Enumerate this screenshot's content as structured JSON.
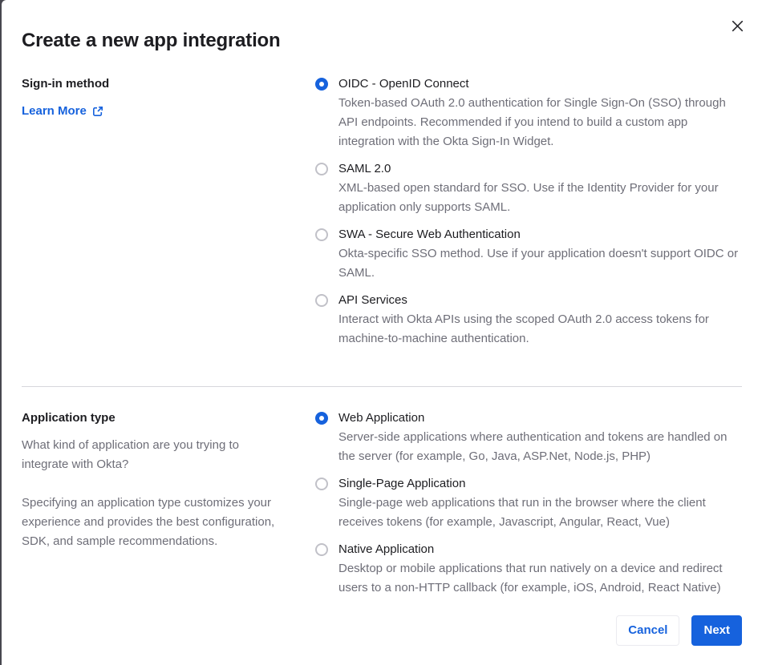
{
  "modal": {
    "title": "Create a new app integration"
  },
  "colors": {
    "accent": "#1662dd",
    "text": "#1d1d21",
    "muted_text": "#6e6e78",
    "divider": "#d7d7dc",
    "scrim": "#47474f",
    "radio_border": "#c1c1c8"
  },
  "sections": [
    {
      "id": "sign-in-method",
      "heading": "Sign-in method",
      "link_label": "Learn More",
      "options": [
        {
          "label": "OIDC - OpenID Connect",
          "description": "Token-based OAuth 2.0 authentication for Single Sign-On (SSO) through API endpoints. Recommended if you intend to build a custom app integration with the Okta Sign-In Widget.",
          "selected": true
        },
        {
          "label": "SAML 2.0",
          "description": "XML-based open standard for SSO. Use if the Identity Provider for your application only supports SAML.",
          "selected": false
        },
        {
          "label": "SWA - Secure Web Authentication",
          "description": "Okta-specific SSO method. Use if your application doesn't support OIDC or SAML.",
          "selected": false
        },
        {
          "label": "API Services",
          "description": "Interact with Okta APIs using the scoped OAuth 2.0 access tokens for machine-to-machine authentication.",
          "selected": false
        }
      ]
    },
    {
      "id": "application-type",
      "heading": "Application type",
      "paragraphs": [
        "What kind of application are you trying to integrate with Okta?",
        "Specifying an application type customizes your experience and provides the best configuration, SDK, and sample recommendations."
      ],
      "options": [
        {
          "label": "Web Application",
          "description": "Server-side applications where authentication and tokens are handled on the server (for example, Go, Java, ASP.Net, Node.js, PHP)",
          "selected": true
        },
        {
          "label": "Single-Page Application",
          "description": "Single-page web applications that run in the browser where the client receives tokens (for example, Javascript, Angular, React, Vue)",
          "selected": false
        },
        {
          "label": "Native Application",
          "description": "Desktop or mobile applications that run natively on a device and redirect users to a non-HTTP callback (for example, iOS, Android, React Native)",
          "selected": false
        }
      ]
    }
  ],
  "footer": {
    "cancel_label": "Cancel",
    "next_label": "Next"
  }
}
